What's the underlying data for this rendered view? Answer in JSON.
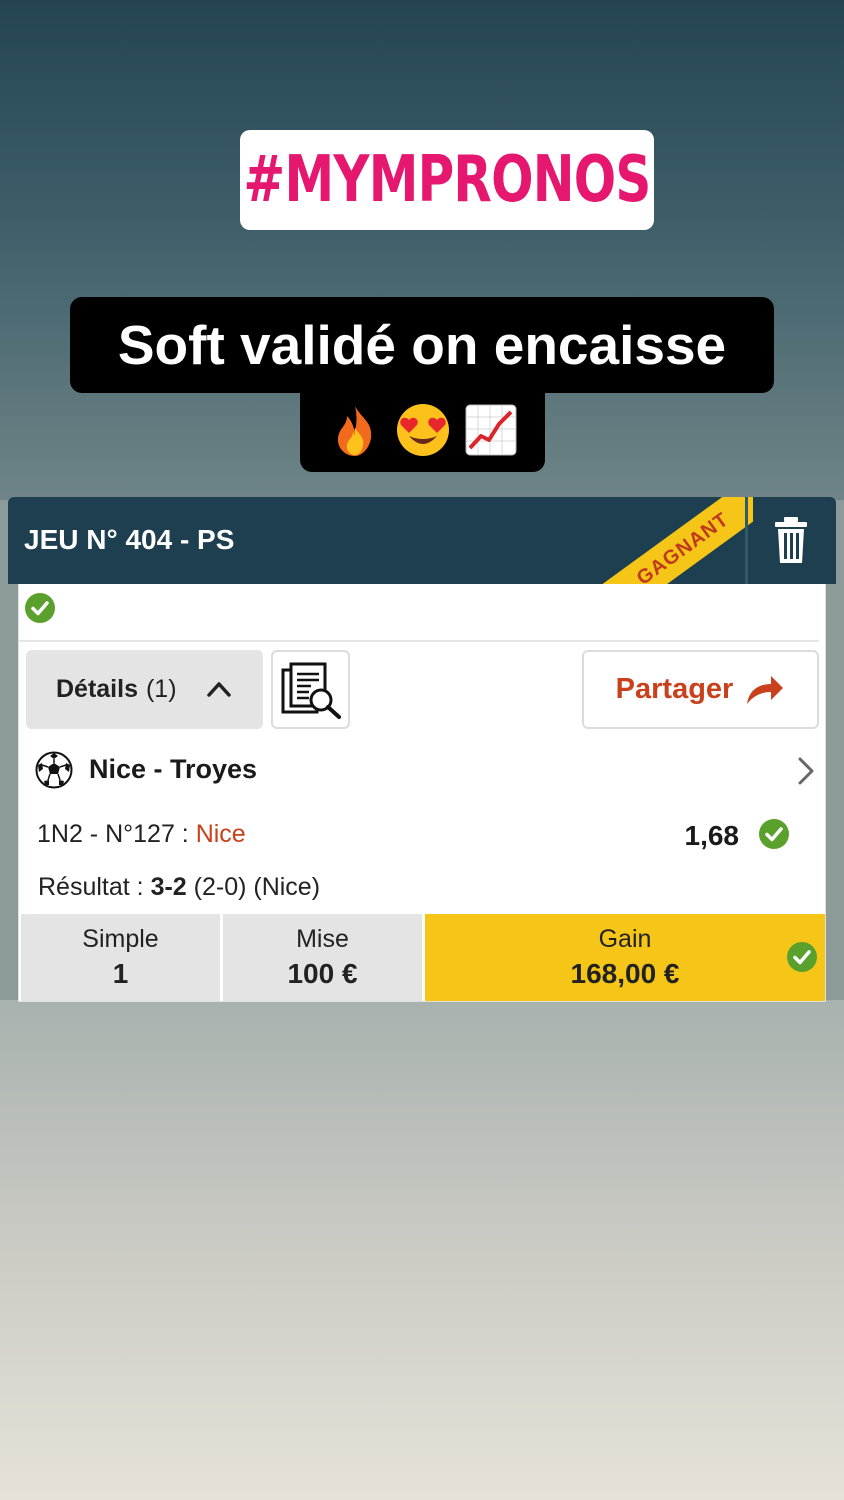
{
  "story": {
    "hashtag": "#MYMPRONOS",
    "caption_line1": "Soft validé on encaisse",
    "caption_emojis": [
      "fire-emoji",
      "heart-eyes-emoji",
      "chart-increasing-emoji"
    ]
  },
  "ticket": {
    "title": "JEU N° 404 - PS",
    "status_ribbon": "GAGNANT",
    "details_label": "Détails",
    "details_count": "(1)",
    "share_label": "Partager",
    "match": {
      "name": "Nice - Troyes",
      "bet_prefix": "1N2 - N°127 : ",
      "bet_pick": "Nice",
      "odds": "1,68",
      "result_prefix": "Résultat : ",
      "result_score": "3-2",
      "result_suffix": " (2-0) (Nice)"
    },
    "summary": {
      "type_label": "Simple",
      "type_value": "1",
      "stake_label": "Mise",
      "stake_value": "100 €",
      "gain_label": "Gain",
      "gain_value": "168,00 €"
    },
    "colors": {
      "header": "#1d3f50",
      "ribbon": "#f5c518",
      "accent": "#c8401c",
      "success": "#5aa02c",
      "hashtag": "#e5176f"
    }
  }
}
